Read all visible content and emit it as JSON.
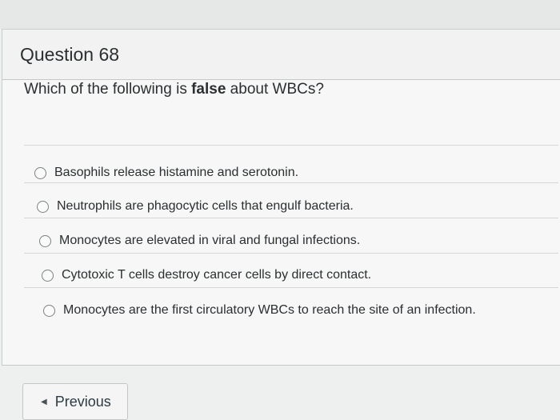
{
  "question": {
    "title": "Question 68",
    "text_before": "Which of the following is ",
    "text_bold": "false",
    "text_after": " about WBCs?"
  },
  "answers": [
    "Basophils release histamine and serotonin.",
    "Neutrophils are phagocytic cells that engulf bacteria.",
    "Monocytes are elevated in viral and fungal infections.",
    "Cytotoxic T cells destroy cancer cells by direct contact.",
    "Monocytes are the first circulatory WBCs to reach the site of an infection."
  ],
  "nav": {
    "previous_label": "Previous",
    "previous_icon": "caret-left-icon"
  }
}
